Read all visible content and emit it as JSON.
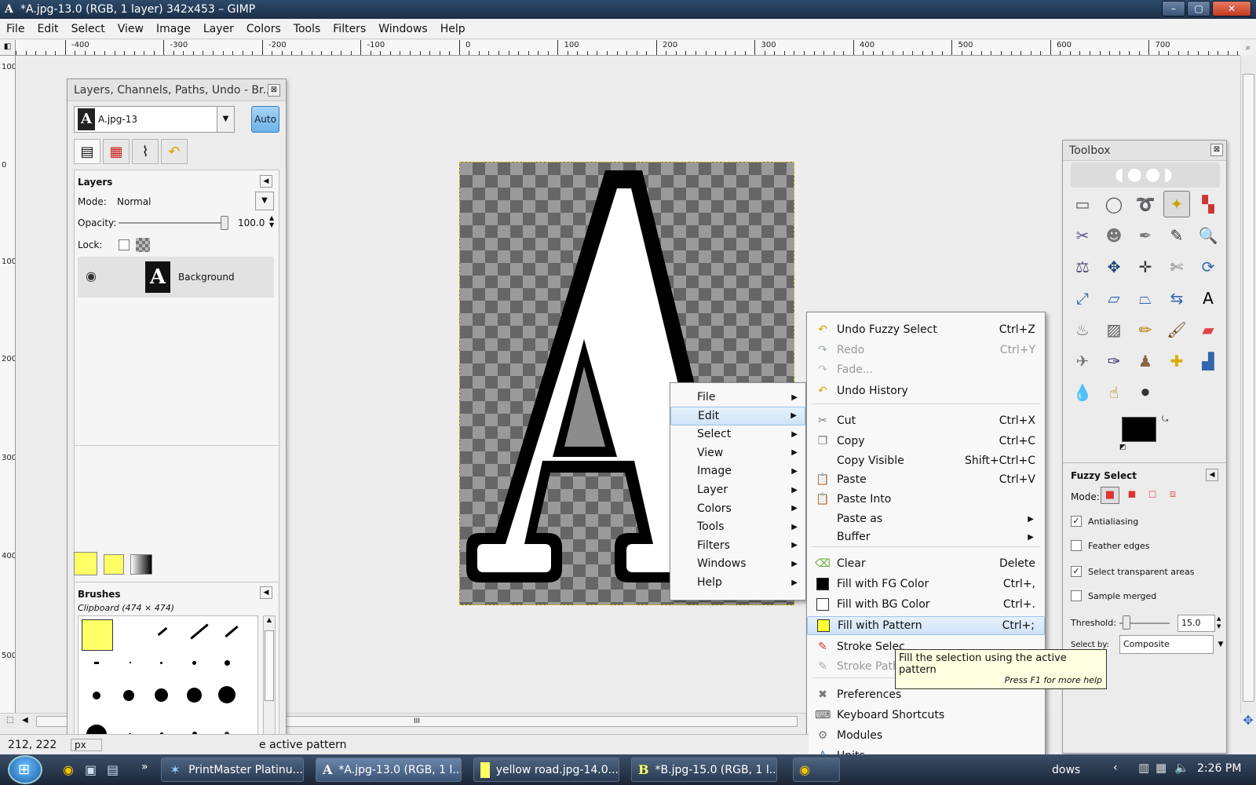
{
  "window": {
    "title": "*A.jpg-13.0 (RGB, 1 layer) 342x453 – GIMP",
    "minimize": "–",
    "maximize": "▢",
    "close": "✕"
  },
  "menubar": [
    "File",
    "Edit",
    "Select",
    "View",
    "Image",
    "Layer",
    "Colors",
    "Tools",
    "Filters",
    "Windows",
    "Help"
  ],
  "ruler": {
    "h_labels": [
      "-400",
      "-300",
      "-200",
      "-100",
      "0",
      "100",
      "200",
      "300",
      "400",
      "500",
      "600",
      "700"
    ],
    "v_labels": [
      "100",
      "0",
      "100",
      "200",
      "300",
      "400",
      "500"
    ]
  },
  "layers_dock": {
    "title": "Layers, Channels, Paths, Undo - Br...",
    "image_select": "A.jpg-13",
    "auto_label": "Auto",
    "layers_title": "Layers",
    "mode_label": "Mode:",
    "mode_value": "Normal",
    "opacity_label": "Opacity:",
    "opacity_value": "100.0",
    "opacity_fraction": 1.0,
    "lock_label": "Lock:",
    "layer_name": "Background",
    "brushes_title": "Brushes",
    "brush_info": "Clipboard (474 × 474)"
  },
  "context_menu": {
    "items": [
      {
        "label": "File",
        "key": "F"
      },
      {
        "label": "Edit",
        "key": "E"
      },
      {
        "label": "Select",
        "key": "S"
      },
      {
        "label": "View",
        "key": "V"
      },
      {
        "label": "Image",
        "key": "I"
      },
      {
        "label": "Layer",
        "key": "L"
      },
      {
        "label": "Colors",
        "key": "C"
      },
      {
        "label": "Tools",
        "key": "T"
      },
      {
        "label": "Filters",
        "key": "r"
      },
      {
        "label": "Windows",
        "key": "W"
      },
      {
        "label": "Help",
        "key": "H"
      }
    ],
    "highlighted": "Edit"
  },
  "edit_menu": {
    "items": [
      {
        "label": "Undo Fuzzy Select",
        "shortcut": "Ctrl+Z",
        "icon": "undo-icon",
        "disabled": false
      },
      {
        "label": "Redo",
        "shortcut": "Ctrl+Y",
        "icon": "redo-icon",
        "disabled": true
      },
      {
        "label": "Fade...",
        "shortcut": "",
        "icon": "fade-icon",
        "disabled": true
      },
      {
        "label": "Undo History",
        "shortcut": "",
        "icon": "undo-history-icon",
        "disabled": false
      },
      {
        "label": "Cut",
        "shortcut": "Ctrl+X",
        "icon": "cut-icon",
        "disabled": false
      },
      {
        "label": "Copy",
        "shortcut": "Ctrl+C",
        "icon": "copy-icon",
        "disabled": false
      },
      {
        "label": "Copy Visible",
        "shortcut": "Shift+Ctrl+C",
        "icon": "",
        "disabled": false
      },
      {
        "label": "Paste",
        "shortcut": "Ctrl+V",
        "icon": "paste-icon",
        "disabled": false
      },
      {
        "label": "Paste Into",
        "shortcut": "",
        "icon": "paste-into-icon",
        "disabled": false
      },
      {
        "label": "Paste as",
        "shortcut": "",
        "icon": "",
        "disabled": false,
        "submenu": true
      },
      {
        "label": "Buffer",
        "shortcut": "",
        "icon": "",
        "disabled": false,
        "submenu": true
      },
      {
        "label": "Clear",
        "shortcut": "Delete",
        "icon": "clear-icon",
        "disabled": false
      },
      {
        "label": "Fill with FG Color",
        "shortcut": "Ctrl+,",
        "icon": "fg-swatch-icon",
        "disabled": false
      },
      {
        "label": "Fill with BG Color",
        "shortcut": "Ctrl+.",
        "icon": "bg-swatch-icon",
        "disabled": false
      },
      {
        "label": "Fill with Pattern",
        "shortcut": "Ctrl+;",
        "icon": "pattern-swatch-icon",
        "disabled": false
      },
      {
        "label": "Stroke Selec",
        "shortcut": "",
        "icon": "stroke-selection-icon",
        "disabled": false
      },
      {
        "label": "Stroke Path",
        "shortcut": "",
        "icon": "stroke-path-icon",
        "disabled": true
      },
      {
        "label": "Preferences",
        "shortcut": "",
        "icon": "preferences-icon",
        "disabled": false
      },
      {
        "label": "Keyboard Shortcuts",
        "shortcut": "",
        "icon": "keyboard-icon",
        "disabled": false
      },
      {
        "label": "Modules",
        "shortcut": "",
        "icon": "modules-icon",
        "disabled": false
      },
      {
        "label": "Units",
        "shortcut": "",
        "icon": "units-icon",
        "disabled": false
      }
    ],
    "highlighted": "Fill with Pattern"
  },
  "tooltip": {
    "text": "Fill the selection using the active pattern",
    "help": "Press F1 for more help"
  },
  "toolbox": {
    "title": "Toolbox",
    "tool_options_title": "Fuzzy Select",
    "mode_label": "Mode:",
    "antialiasing": "Antialiasing",
    "feather": "Feather edges",
    "select_transparent": "Select transparent areas",
    "sample_merged": "Sample merged",
    "threshold_label": "Threshold:",
    "threshold_value": "15.0",
    "threshold_fraction": 0.06,
    "select_by_label": "Select by:",
    "select_by_value": "Composite"
  },
  "status": {
    "coords": "212, 222",
    "unit": "px",
    "message": "e active pattern"
  },
  "taskbar": {
    "tasks": [
      {
        "label": "PrintMaster Platinu...",
        "icon": "printmaster-icon"
      },
      {
        "label": "*A.jpg-13.0 (RGB, 1 l...",
        "icon": "gimp-a-icon"
      },
      {
        "label": "yellow road.jpg-14.0...",
        "icon": "yellow-image-icon"
      },
      {
        "label": "*B.jpg-15.0 (RGB, 1 l...",
        "icon": "gimp-b-icon"
      },
      {
        "label": "dows",
        "icon": "windows-icon"
      }
    ],
    "clock": "2:26 PM"
  },
  "colors": {
    "fg": "#000000",
    "bg": "#ffffff",
    "pattern": "#ffff66",
    "accent": "#ffff66"
  }
}
